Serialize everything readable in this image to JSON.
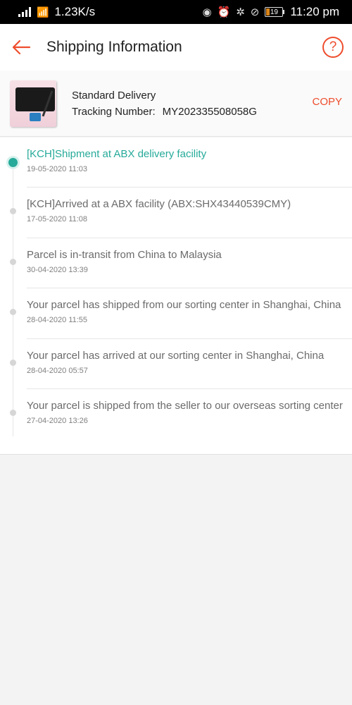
{
  "status_bar": {
    "speed": "1.23K/s",
    "battery": "19",
    "time": "11:20 pm",
    "icons": [
      "signal-icon",
      "wifi-icon",
      "eye-icon",
      "alarm-icon",
      "bluetooth-icon",
      "mute-icon",
      "battery-icon"
    ]
  },
  "header": {
    "title": "Shipping Information",
    "back_icon": "back-arrow-icon",
    "help_icon": "help-icon",
    "help_glyph": "?"
  },
  "shipment": {
    "delivery_type": "Standard Delivery",
    "tracking_label": "Tracking Number:",
    "tracking_number": "MY202335508058G",
    "copy_label": "COPY"
  },
  "colors": {
    "accent": "#ee4d2d",
    "current_status": "#26aa99"
  },
  "events": [
    {
      "desc": "[KCH]Shipment at ABX delivery facility",
      "time": "19-05-2020 11:03",
      "current": true
    },
    {
      "desc": "[KCH]Arrived at a ABX facility (ABX:SHX43440539CMY)",
      "time": "17-05-2020 11:08"
    },
    {
      "desc": "Parcel is in-transit from China to Malaysia",
      "time": "30-04-2020 13:39"
    },
    {
      "desc": "Your parcel has shipped from our sorting center in Shanghai, China",
      "time": "28-04-2020 11:55"
    },
    {
      "desc": "Your parcel has arrived at our sorting center in Shanghai, China",
      "time": "28-04-2020 05:57"
    },
    {
      "desc": "Your parcel is shipped from the seller to our overseas sorting center",
      "time": "27-04-2020 13:26"
    }
  ]
}
